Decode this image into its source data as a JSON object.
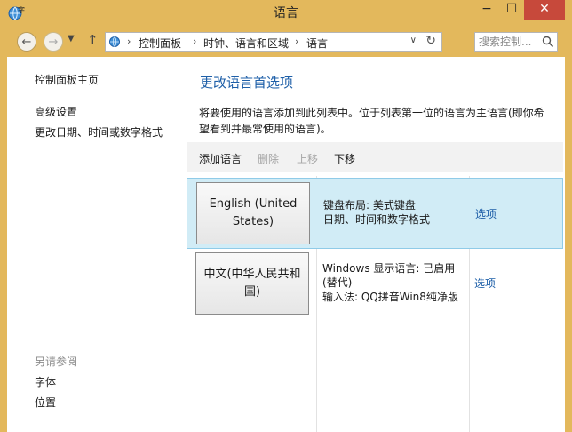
{
  "window": {
    "title": "语言",
    "min_glyph": "−",
    "max_glyph": "☐",
    "close_glyph": "✕",
    "icon": "language-control-panel-icon"
  },
  "nav": {
    "back_glyph": "←",
    "forward_glyph": "→",
    "recent_glyph": "▼",
    "up_glyph": "↑",
    "breadcrumb": [
      "控制面板",
      "时钟、语言和区域",
      "语言"
    ],
    "separator": "›",
    "dropdown_glyph": "∨",
    "refresh_glyph": "↻",
    "search_placeholder": "搜索控制..."
  },
  "sidebar": {
    "home": "控制面板主页",
    "links": [
      "高级设置",
      "更改日期、时间或数字格式"
    ],
    "see_also_label": "另请参阅",
    "see_also": [
      "字体",
      "位置"
    ]
  },
  "main": {
    "title": "更改语言首选项",
    "description": "将要使用的语言添加到此列表中。位于列表第一位的语言为主语言(即你希望看到并最常使用的语言)。",
    "toolbar": {
      "add": "添加语言",
      "remove": "删除",
      "up": "上移",
      "down": "下移"
    },
    "languages": [
      {
        "name": "English (United States)",
        "info": [
          "键盘布局: 美式键盘",
          "日期、时间和数字格式"
        ],
        "options": "选项",
        "selected": true
      },
      {
        "name": "中文(中华人民共和国)",
        "info": [
          "Windows 显示语言: 已启用(替代)",
          "输入法: QQ拼音Win8纯净版"
        ],
        "options": "选项",
        "selected": false
      }
    ]
  },
  "colors": {
    "frame": "#e3b85c",
    "close": "#c7493b",
    "link": "#1e5fa8",
    "selection": "#d1ecf6"
  }
}
